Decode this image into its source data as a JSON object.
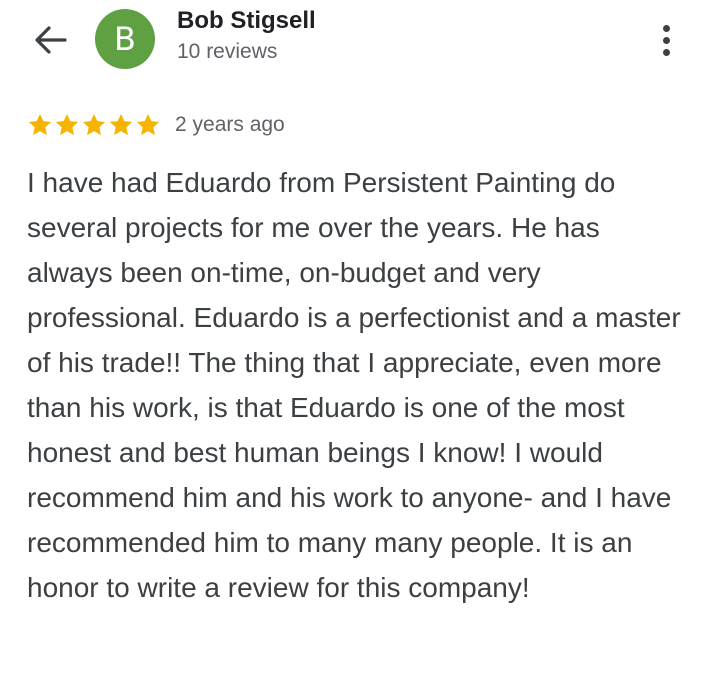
{
  "header": {
    "back_icon": "arrow-back-icon",
    "avatar_letter": "B",
    "avatar_color": "#5fa043",
    "reviewer_name": "Bob Stigsell",
    "review_count": "10 reviews",
    "more_icon": "more-vert-icon"
  },
  "review": {
    "rating": 5,
    "rating_max": 5,
    "star_color": "#f4b400",
    "time_ago": "2 years ago",
    "text": "I have had Eduardo from Persistent Painting do several projects for me over the years. He has always been on-time, on-budget and very professional. Eduardo is a perfectionist and a master of his trade!! The thing that I appreciate, even more than his work, is that Eduardo is one of the most honest and best human beings I know! I would recommend him and his work to anyone- and I have recommended him to many many people. It is an honor to write a review for this company!"
  }
}
